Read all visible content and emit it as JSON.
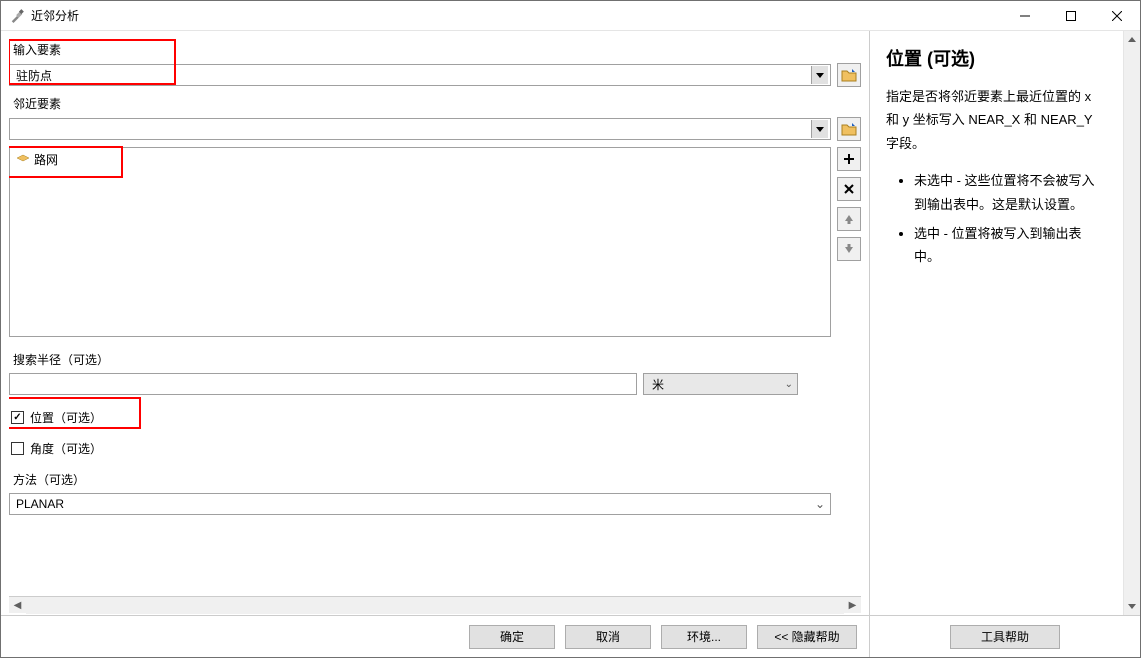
{
  "window": {
    "title": "近邻分析"
  },
  "form": {
    "input_features": {
      "label": "输入要素",
      "value": "驻防点"
    },
    "near_features": {
      "label": "邻近要素",
      "value": "",
      "items": [
        "路网"
      ]
    },
    "search_radius": {
      "label": "搜索半径（可选）",
      "value": "",
      "unit": "米"
    },
    "location": {
      "label": "位置（可选）",
      "checked": true
    },
    "angle": {
      "label": "角度（可选）",
      "checked": false
    },
    "method": {
      "label": "方法（可选）",
      "value": "PLANAR"
    }
  },
  "buttons": {
    "ok": "确定",
    "cancel": "取消",
    "environments": "环境...",
    "hide_help": "<<  隐藏帮助",
    "tool_help": "工具帮助"
  },
  "help": {
    "title": "位置 (可选)",
    "para": "指定是否将邻近要素上最近位置的 x 和 y 坐标写入 NEAR_X 和 NEAR_Y 字段。",
    "bullets": [
      "未选中 - 这些位置将不会被写入到输出表中。这是默认设置。",
      "选中 - 位置将被写入到输出表中。"
    ]
  }
}
